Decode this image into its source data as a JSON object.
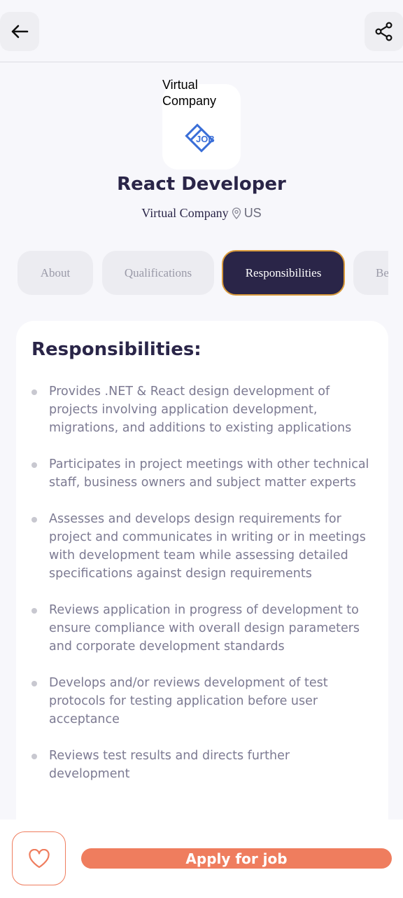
{
  "header": {
    "back_icon": "arrow-left-icon",
    "share_icon": "share-icon"
  },
  "company": {
    "logo_alt": "Virtual Company",
    "logo_text": "JOB",
    "name": "Virtual Company",
    "location": "US",
    "location_icon": "map-pin-icon"
  },
  "job": {
    "title": "React Developer"
  },
  "tabs": [
    {
      "label": "About"
    },
    {
      "label": "Qualifications"
    },
    {
      "label": "Responsibilities"
    },
    {
      "label": "Benefits"
    }
  ],
  "active_tab": "Responsibilities",
  "section": {
    "title": "Responsibilities:",
    "items": [
      "Provides .NET & React design development of projects involving application development, migrations, and additions to existing applications",
      "Participates in project meetings with other technical staff, business owners and subject matter experts",
      "Assesses and develops design requirements for project and communicates in writing or in meetings with development team while assessing detailed specifications against design requirements",
      "Reviews application in progress of development to ensure compliance with overall design parameters and corporate development standards",
      "Develops and/or reviews development of test protocols for testing application before user acceptance",
      "Reviews test results and directs further development"
    ]
  },
  "footer": {
    "favorite_icon": "heart-icon",
    "apply_label": "Apply for job"
  },
  "colors": {
    "primary": "#2a2548",
    "accent": "#ef7d5e",
    "active_tab_border": "#d99a3b",
    "logo_blue": "#3b6fd8"
  }
}
